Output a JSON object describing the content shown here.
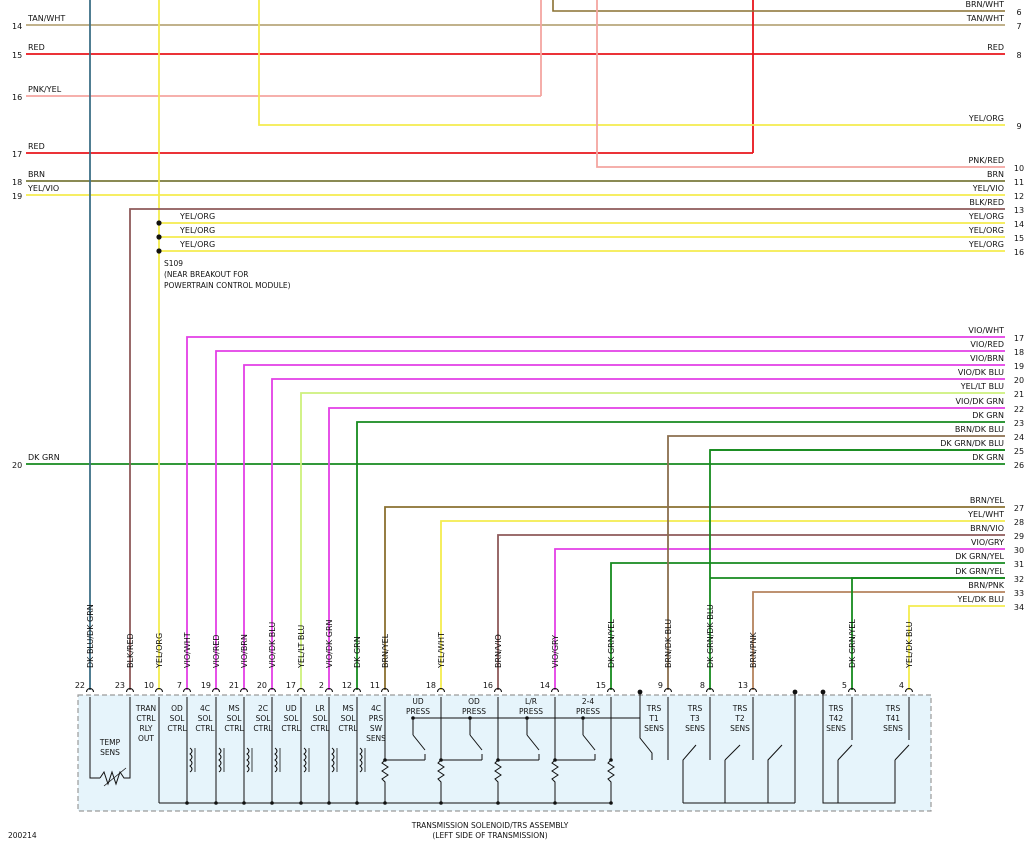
{
  "colors": {
    "TAN": "#b8a77c",
    "RED": "#e8151b",
    "PNK": "#f4a5a0",
    "YEL": "#f4ec4e",
    "BRN": "#8a7030",
    "BLU_DK": "#3d6f86",
    "BLK": "#8e5a5a",
    "VIO": "#e33fe6",
    "LTGRN": "#cdf07c",
    "GRN": "#168a1e",
    "BRNDK": "#8b6f4e",
    "BRNPNK": "#b5835d",
    "OLIVE": "#7a7a3c",
    "BOX": "#e6f4fb",
    "BOXSTROKE": "#9a9a9a",
    "BLACK": "#111111"
  },
  "left_wires": [
    {
      "pin": "14",
      "label": "TAN/WHT"
    },
    {
      "pin": "15",
      "label": "RED"
    },
    {
      "pin": "16",
      "label": "PNK/YEL"
    },
    {
      "pin": "17",
      "label": "RED"
    },
    {
      "pin": "18",
      "label": "BRN"
    },
    {
      "pin": "19",
      "label": "YEL/VIO"
    },
    {
      "pin": "20",
      "label": "DK GRN"
    }
  ],
  "right_wires": [
    {
      "pin": "6",
      "label": "BRN/WHT"
    },
    {
      "pin": "7",
      "label": "TAN/WHT"
    },
    {
      "pin": "8",
      "label": "RED"
    },
    {
      "pin": "9",
      "label": "YEL/ORG"
    },
    {
      "pin": "10",
      "label": "PNK/RED"
    },
    {
      "pin": "11",
      "label": "BRN"
    },
    {
      "pin": "12",
      "label": "YEL/VIO"
    },
    {
      "pin": "13",
      "label": "BLK/RED"
    },
    {
      "pin": "14",
      "label": "YEL/ORG"
    },
    {
      "pin": "15",
      "label": "YEL/ORG"
    },
    {
      "pin": "16",
      "label": "YEL/ORG"
    },
    {
      "pin": "17",
      "label": "VIO/WHT"
    },
    {
      "pin": "18",
      "label": "VIO/RED"
    },
    {
      "pin": "19",
      "label": "VIO/BRN"
    },
    {
      "pin": "20",
      "label": "VIO/DK BLU"
    },
    {
      "pin": "21",
      "label": "YEL/LT BLU"
    },
    {
      "pin": "22",
      "label": "VIO/DK GRN"
    },
    {
      "pin": "23",
      "label": "DK GRN"
    },
    {
      "pin": "24",
      "label": "BRN/DK BLU"
    },
    {
      "pin": "25",
      "label": "DK GRN/DK BLU"
    },
    {
      "pin": "26",
      "label": "DK GRN"
    },
    {
      "pin": "27",
      "label": "BRN/YEL"
    },
    {
      "pin": "28",
      "label": "YEL/WHT"
    },
    {
      "pin": "29",
      "label": "BRN/VIO"
    },
    {
      "pin": "30",
      "label": "VIO/GRY"
    },
    {
      "pin": "31",
      "label": "DK GRN/YEL"
    },
    {
      "pin": "32",
      "label": "DK GRN/YEL"
    },
    {
      "pin": "33",
      "label": "BRN/PNK"
    },
    {
      "pin": "34",
      "label": "YEL/DK BLU"
    }
  ],
  "splice_labels": [
    "YEL/ORG",
    "YEL/ORG",
    "YEL/ORG"
  ],
  "splice_note": [
    "S109",
    "(NEAR BREAKOUT FOR",
    "POWERTRAIN CONTROL MODULE)"
  ],
  "connector_pins": [
    {
      "pin": "22",
      "label": "DK BLU/DK GRN"
    },
    {
      "pin": "23",
      "label": "BLK/RED"
    },
    {
      "pin": "10",
      "label": "YEL/ORG"
    },
    {
      "pin": "7",
      "label": "VIO/WHT"
    },
    {
      "pin": "19",
      "label": "VIO/RED"
    },
    {
      "pin": "21",
      "label": "VIO/BRN"
    },
    {
      "pin": "20",
      "label": "VIO/DK BLU"
    },
    {
      "pin": "17",
      "label": "YEL/LT BLU"
    },
    {
      "pin": "2",
      "label": "VIO/DK GRN"
    },
    {
      "pin": "12",
      "label": "DK GRN"
    },
    {
      "pin": "11",
      "label": "BRN/YEL"
    },
    {
      "pin": "18",
      "label": "YEL/WHT"
    },
    {
      "pin": "16",
      "label": "BRN/VIO"
    },
    {
      "pin": "14",
      "label": "VIO/GRY"
    },
    {
      "pin": "15",
      "label": "DK GRN/YEL"
    },
    {
      "pin": "9",
      "label": "BRN/DK BLU"
    },
    {
      "pin": "8",
      "label": "DK GRN/DK BLU"
    },
    {
      "pin": "13",
      "label": "BRN/PNK"
    },
    {
      "pin": "5",
      "label": "DK GRN/YEL"
    },
    {
      "pin": "4",
      "label": "YEL/DK BLU"
    }
  ],
  "components": [
    [
      "TEMP",
      "SENS"
    ],
    [
      "TRAN",
      "CTRL",
      "RLY",
      "OUT"
    ],
    [
      "OD",
      "SOL",
      "CTRL"
    ],
    [
      "4C",
      "SOL",
      "CTRL"
    ],
    [
      "MS",
      "SOL",
      "CTRL"
    ],
    [
      "2C",
      "SOL",
      "CTRL"
    ],
    [
      "UD",
      "SOL",
      "CTRL"
    ],
    [
      "LR",
      "SOL",
      "CTRL"
    ],
    [
      "MS",
      "SOL",
      "CTRL"
    ],
    [
      "4C",
      "PRS",
      "SW",
      "SENS"
    ],
    [
      "UD",
      "PRESS"
    ],
    [
      "OD",
      "PRESS"
    ],
    [
      "L/R",
      "PRESS"
    ],
    [
      "2-4",
      "PRESS"
    ],
    [
      "TRS",
      "T1",
      "SENS"
    ],
    [
      "TRS",
      "T3",
      "SENS"
    ],
    [
      "TRS",
      "T2",
      "SENS"
    ],
    [
      "TRS",
      "T42",
      "SENS"
    ],
    [
      "TRS",
      "T41",
      "SENS"
    ]
  ],
  "assembly_title": "TRANSMISSION SOLENOID/TRS ASSEMBLY",
  "assembly_subtitle": "(LEFT SIDE OF TRANSMISSION)",
  "figure_id": "200214"
}
